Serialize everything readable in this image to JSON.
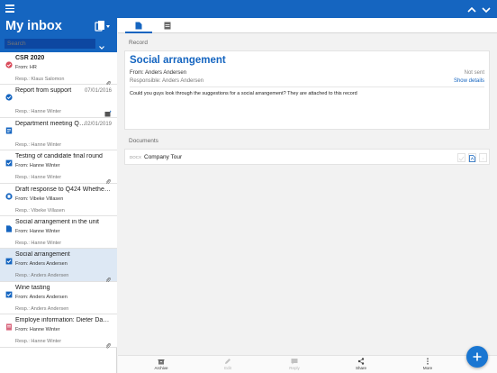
{
  "app": {
    "inbox_title": "My inbox",
    "search_placeholder": "Search"
  },
  "colors": {
    "accent": "#1565c0",
    "selected_row": "#dde8f4",
    "fab": "#1976d2"
  },
  "inbox_items": [
    {
      "title": "CSR 2020",
      "bold": true,
      "date": "",
      "from": "From: HR",
      "resp": "Resp.: Klaus Salomon",
      "icon": "red-check-circle-icon",
      "attachment": true,
      "flag": false
    },
    {
      "title": "Report from support",
      "bold": false,
      "date": "07/01/2016",
      "from": "",
      "resp": "Resp.: Hanne Winter",
      "icon": "blue-check-circle-icon",
      "attachment": false,
      "flag": true
    },
    {
      "title": "Department meeting Q1...",
      "bold": false,
      "date": "02/01/2019",
      "from": "",
      "resp": "Resp.: Hanne Winter",
      "icon": "meeting-document-icon",
      "attachment": false,
      "flag": false
    },
    {
      "title": "Testing of candidate final round",
      "bold": false,
      "date": "",
      "from": "From: Hanne Winter",
      "resp": "Resp.: Hanne Winter",
      "icon": "task-checkbox-icon",
      "attachment": true,
      "flag": false
    },
    {
      "title": "Draft response to Q424 Whether c...",
      "bold": false,
      "date": "",
      "from": "From: Vibeke Villasen",
      "resp": "Resp.: Vibeke Villasen",
      "icon": "case-circle-icon",
      "attachment": false,
      "flag": false
    },
    {
      "title": "Social arrangement in the unit",
      "bold": false,
      "date": "",
      "from": "From: Hanne Winter",
      "resp": "Resp.: Hanne Winter",
      "icon": "document-icon",
      "attachment": false,
      "flag": false
    },
    {
      "title": "Social arrangement",
      "bold": false,
      "date": "",
      "from": "From: Anders Andersen",
      "resp": "Resp.: Anders Andersen",
      "icon": "task-checkbox-icon",
      "attachment": true,
      "flag": false,
      "selected": true
    },
    {
      "title": "Wine tasting",
      "bold": false,
      "date": "",
      "from": "From: Anders Andersen",
      "resp": "Resp.: Anders Andersen",
      "icon": "task-checkbox-icon",
      "attachment": false,
      "flag": false
    },
    {
      "title": "Employe information: Dieter David...",
      "bold": false,
      "date": "",
      "from": "From: Hanne Winter",
      "resp": "Resp.: Hanne Winter",
      "icon": "pink-document-icon",
      "attachment": true,
      "flag": false
    }
  ],
  "record": {
    "section_label": "Record",
    "title": "Social arrangement",
    "from": "From: Anders Andersen",
    "responsible": "Responsible: Anders Andersen",
    "status": "Not sent",
    "show_details": "Show details",
    "body": "Could you guys look through the suggestions for a social arrangement? They are attached to this record"
  },
  "documents": {
    "section_label": "Documents",
    "items": [
      {
        "type": "DOCX",
        "name": "Company Tour"
      }
    ]
  },
  "toolbar": {
    "archive": "Archive",
    "edit": "Edit",
    "reply": "Reply",
    "share": "Share",
    "more": "More"
  }
}
